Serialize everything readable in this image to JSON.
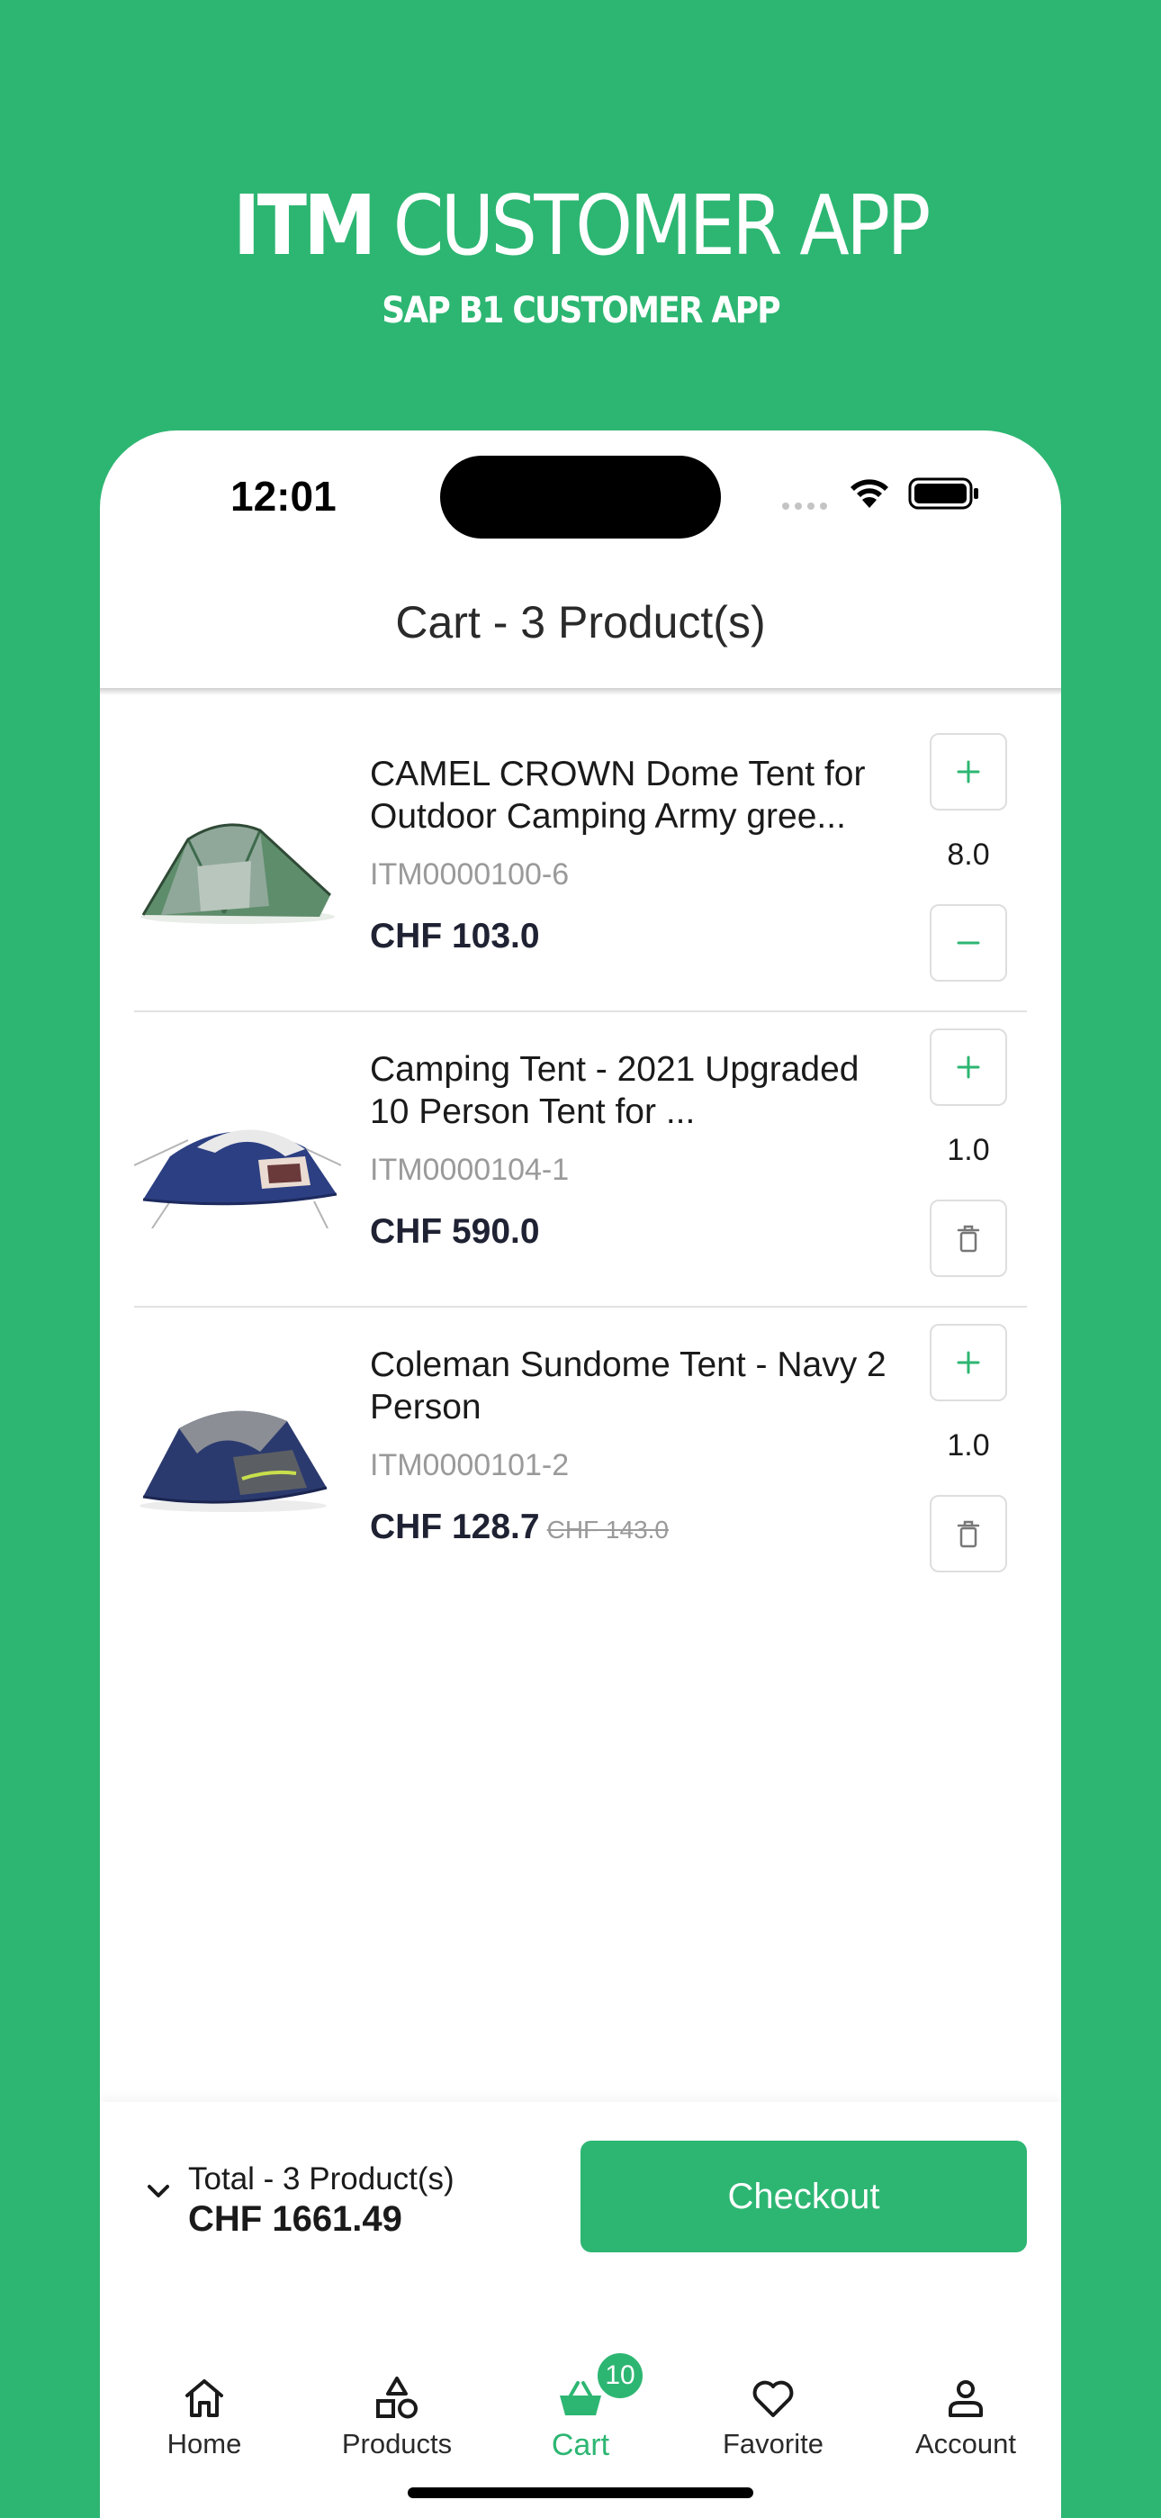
{
  "promo": {
    "title_bold": "ITM",
    "title_rest": "CUSTOMER APP",
    "subtitle": "SAP B1 CUSTOMER APP"
  },
  "status_bar": {
    "time": "12:01"
  },
  "header": {
    "title": "Cart - 3 Product(s)"
  },
  "cart": {
    "items": [
      {
        "name": "CAMEL CROWN Dome Tent for Outdoor Camping Army gree...",
        "code": "ITM0000100-6",
        "price": "CHF 103.0",
        "old_price": "",
        "quantity": "8.0",
        "decrease_action": "minus-icon",
        "image": "green-dome-tent"
      },
      {
        "name": "Camping Tent - 2021 Upgraded 10 Person Tent for ...",
        "code": "ITM0000104-1",
        "price": "CHF 590.0",
        "old_price": "",
        "quantity": "1.0",
        "decrease_action": "trash-icon",
        "image": "navy-white-family-tent"
      },
      {
        "name": "Coleman Sundome Tent - Navy 2 Person",
        "code": "ITM0000101-2",
        "price": "CHF 128.7",
        "old_price": "CHF 143.0",
        "quantity": "1.0",
        "decrease_action": "trash-icon",
        "image": "navy-grey-dome-tent"
      }
    ]
  },
  "summary": {
    "label": "Total - 3 Product(s)",
    "amount": "CHF 1661.49",
    "checkout_label": "Checkout"
  },
  "tabs": [
    {
      "label": "Home",
      "icon": "home-icon",
      "active": false
    },
    {
      "label": "Products",
      "icon": "shapes-icon",
      "active": false
    },
    {
      "label": "Cart",
      "icon": "basket-icon",
      "active": true,
      "badge": "10"
    },
    {
      "label": "Favorite",
      "icon": "heart-icon",
      "active": false
    },
    {
      "label": "Account",
      "icon": "person-icon",
      "active": false
    }
  ],
  "colors": {
    "brand": "#2db672",
    "text_dark": "#1f2233",
    "muted": "#9a9a9a"
  }
}
